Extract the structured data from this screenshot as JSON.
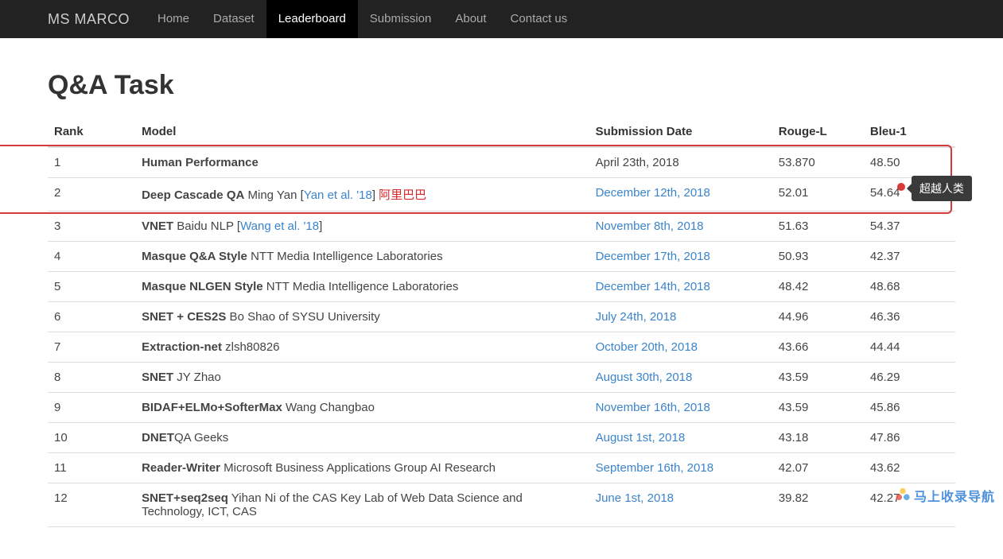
{
  "brand": "MS MARCO",
  "nav": [
    {
      "label": "Home",
      "active": false
    },
    {
      "label": "Dataset",
      "active": false
    },
    {
      "label": "Leaderboard",
      "active": true
    },
    {
      "label": "Submission",
      "active": false
    },
    {
      "label": "About",
      "active": false
    },
    {
      "label": "Contact us",
      "active": false
    }
  ],
  "page_title": "Q&A Task",
  "columns": {
    "rank": "Rank",
    "model": "Model",
    "date": "Submission Date",
    "rouge": "Rouge-L",
    "bleu": "Bleu-1"
  },
  "callout": {
    "text": "超越人类"
  },
  "watermark": {
    "text": "马上收录导航"
  },
  "rows": [
    {
      "rank": "1",
      "model_bold": "Human Performance",
      "model_rest": "",
      "citation": "",
      "suffix": "",
      "date": "April 23th, 2018",
      "date_link": false,
      "rouge": "53.870",
      "bleu": "48.50"
    },
    {
      "rank": "2",
      "model_bold": "Deep Cascade QA",
      "model_rest": " Ming Yan [",
      "citation": "Yan et al. '18",
      "post_citation": "]   ",
      "suffix": "阿里巴巴",
      "suffix_red": true,
      "date": "December 12th, 2018",
      "date_link": true,
      "rouge": "52.01",
      "bleu": "54.64"
    },
    {
      "rank": "3",
      "model_bold": "VNET",
      "model_rest": " Baidu NLP [",
      "citation": "Wang et al. '18",
      "post_citation": "]",
      "suffix": "",
      "date": "November 8th, 2018",
      "date_link": true,
      "rouge": "51.63",
      "bleu": "54.37"
    },
    {
      "rank": "4",
      "model_bold": "Masque Q&A Style",
      "model_rest": " NTT Media Intelligence Laboratories",
      "citation": "",
      "suffix": "",
      "date": "December 17th, 2018",
      "date_link": true,
      "rouge": "50.93",
      "bleu": "42.37"
    },
    {
      "rank": "5",
      "model_bold": "Masque NLGEN Style",
      "model_rest": " NTT Media Intelligence Laboratories",
      "citation": "",
      "suffix": "",
      "date": "December 14th, 2018",
      "date_link": true,
      "rouge": "48.42",
      "bleu": "48.68"
    },
    {
      "rank": "6",
      "model_bold": "SNET + CES2S",
      "model_rest": " Bo Shao of SYSU University",
      "citation": "",
      "suffix": "",
      "date": "July 24th, 2018",
      "date_link": true,
      "rouge": "44.96",
      "bleu": "46.36"
    },
    {
      "rank": "7",
      "model_bold": "Extraction-net",
      "model_rest": " zlsh80826",
      "citation": "",
      "suffix": "",
      "date": "October 20th, 2018",
      "date_link": true,
      "rouge": "43.66",
      "bleu": "44.44"
    },
    {
      "rank": "8",
      "model_bold": "SNET",
      "model_rest": " JY Zhao",
      "citation": "",
      "suffix": "",
      "date": "August 30th, 2018",
      "date_link": true,
      "rouge": "43.59",
      "bleu": "46.29"
    },
    {
      "rank": "9",
      "model_bold": "BIDAF+ELMo+SofterMax",
      "model_rest": " Wang Changbao",
      "citation": "",
      "suffix": "",
      "date": "November 16th, 2018",
      "date_link": true,
      "rouge": "43.59",
      "bleu": "45.86"
    },
    {
      "rank": "10",
      "model_bold": "DNET",
      "model_rest": "QA Geeks",
      "citation": "",
      "suffix": "",
      "date": "August 1st, 2018",
      "date_link": true,
      "rouge": "43.18",
      "bleu": "47.86"
    },
    {
      "rank": "11",
      "model_bold": "Reader-Writer",
      "model_rest": " Microsoft Business Applications Group AI Research",
      "citation": "",
      "suffix": "",
      "date": "September 16th, 2018",
      "date_link": true,
      "rouge": "42.07",
      "bleu": "43.62"
    },
    {
      "rank": "12",
      "model_bold": "SNET+seq2seq",
      "model_rest": " Yihan Ni of the CAS Key Lab of Web Data Science and Technology, ICT, CAS",
      "citation": "",
      "suffix": "",
      "date": "June 1st, 2018",
      "date_link": true,
      "rouge": "39.82",
      "bleu": "42.27"
    }
  ]
}
